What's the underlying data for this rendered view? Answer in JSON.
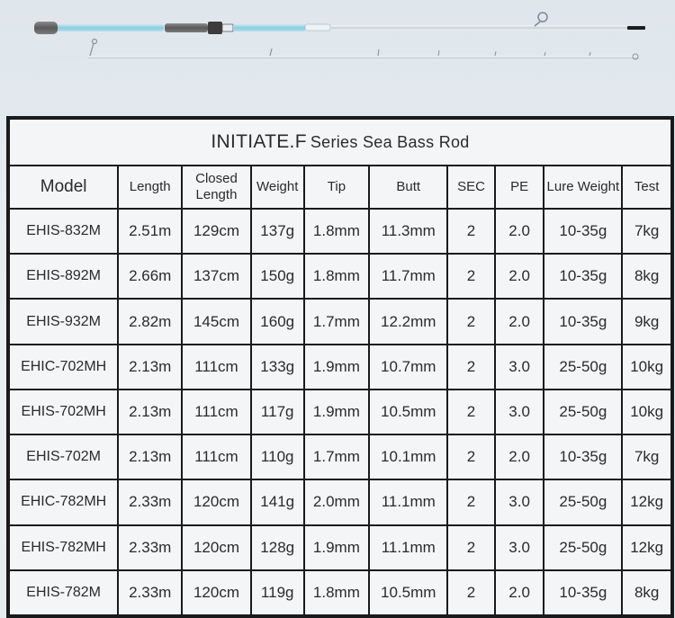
{
  "title": {
    "main": "INITIATE.F",
    "sub": "Series Sea Bass Rod"
  },
  "headers": [
    {
      "key": "model",
      "label": "Model"
    },
    {
      "key": "length",
      "label": "Length"
    },
    {
      "key": "closed_length",
      "label": "Closed Length"
    },
    {
      "key": "weight",
      "label": "Weight"
    },
    {
      "key": "tip",
      "label": "Tip"
    },
    {
      "key": "butt",
      "label": "Butt"
    },
    {
      "key": "sec",
      "label": "SEC"
    },
    {
      "key": "pe",
      "label": "PE"
    },
    {
      "key": "lure_weight",
      "label": "Lure Weight"
    },
    {
      "key": "test",
      "label": "Test"
    }
  ],
  "rows": [
    [
      "EHIS-832M",
      "2.51m",
      "129cm",
      "137g",
      "1.8mm",
      "11.3mm",
      "2",
      "2.0",
      "10-35g",
      "7kg"
    ],
    [
      "EHIS-892M",
      "2.66m",
      "137cm",
      "150g",
      "1.8mm",
      "11.7mm",
      "2",
      "2.0",
      "10-35g",
      "8kg"
    ],
    [
      "EHIS-932M",
      "2.82m",
      "145cm",
      "160g",
      "1.7mm",
      "12.2mm",
      "2",
      "2.0",
      "10-35g",
      "9kg"
    ],
    [
      "EHIC-702MH",
      "2.13m",
      "111cm",
      "133g",
      "1.9mm",
      "10.7mm",
      "2",
      "3.0",
      "25-50g",
      "10kg"
    ],
    [
      "EHIS-702MH",
      "2.13m",
      "111cm",
      "117g",
      "1.9mm",
      "10.5mm",
      "2",
      "3.0",
      "25-50g",
      "10kg"
    ],
    [
      "EHIS-702M",
      "2.13m",
      "111cm",
      "110g",
      "1.7mm",
      "10.1mm",
      "2",
      "2.0",
      "10-35g",
      "7kg"
    ],
    [
      "EHIC-782MH",
      "2.33m",
      "120cm",
      "141g",
      "2.0mm",
      "11.1mm",
      "2",
      "3.0",
      "25-50g",
      "12kg"
    ],
    [
      "EHIS-782MH",
      "2.33m",
      "120cm",
      "128g",
      "1.9mm",
      "11.1mm",
      "2",
      "3.0",
      "25-50g",
      "12kg"
    ],
    [
      "EHIS-782M",
      "2.33m",
      "120cm",
      "119g",
      "1.8mm",
      "10.5mm",
      "2",
      "2.0",
      "10-35g",
      "8kg"
    ]
  ],
  "colors": {
    "rod_blank": "#9fd4e6",
    "grip": "#6a6a6a",
    "table_border": "#1a1a1a",
    "cell_bg": "#f3f5f7"
  }
}
